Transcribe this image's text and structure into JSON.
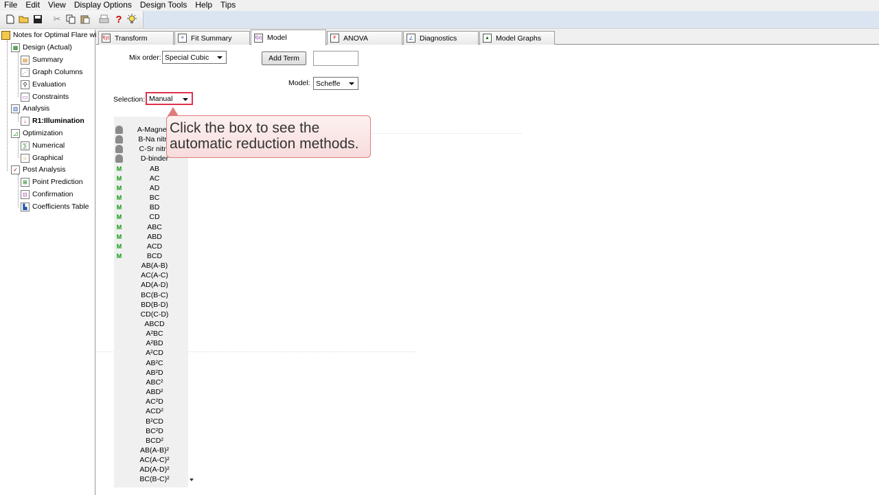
{
  "menubar": {
    "items": [
      "File",
      "Edit",
      "View",
      "Display Options",
      "Design Tools",
      "Help",
      "Tips"
    ]
  },
  "toolbar": {
    "icons": [
      "new-file-icon",
      "open-folder-icon",
      "save-icon",
      "cut-icon",
      "copy-icon",
      "paste-icon",
      "print-icon",
      "help-icon",
      "tip-bulb-icon"
    ],
    "help_glyph": "?"
  },
  "tree": {
    "root": "Notes for Optimal Flare wit",
    "design": "Design (Actual)",
    "summary": "Summary",
    "graph_columns": "Graph Columns",
    "evaluation": "Evaluation",
    "constraints": "Constraints",
    "analysis": "Analysis",
    "r1": "R1:Illumination",
    "optimization": "Optimization",
    "numerical": "Numerical",
    "graphical": "Graphical",
    "post_analysis": "Post Analysis",
    "point_prediction": "Point Prediction",
    "confirmation": "Confirmation",
    "coefficients_table": "Coefficients Table"
  },
  "tabs": [
    {
      "label": "Transform",
      "icon": "f(y)"
    },
    {
      "label": "Fit Summary",
      "icon": "≡"
    },
    {
      "label": "Model",
      "icon": "f(x)"
    },
    {
      "label": "ANOVA",
      "icon": "F"
    },
    {
      "label": "Diagnostics",
      "icon": "∠"
    },
    {
      "label": "Model Graphs",
      "icon": "▲"
    }
  ],
  "model": {
    "mix_order_label": "Mix order:",
    "mix_order_value": "Special Cubic",
    "add_term_label": "Add Term",
    "add_term_value": "",
    "model_label": "Model:",
    "model_value": "Scheffe",
    "selection_label": "Selection:",
    "selection_value": "Manual"
  },
  "terms": [
    {
      "name": "A-Magnesi",
      "mark": "lock"
    },
    {
      "name": "B-Na nitra",
      "mark": "lock"
    },
    {
      "name": "C-Sr nitra",
      "mark": "lock"
    },
    {
      "name": "D-binder",
      "mark": "lock"
    },
    {
      "name": "AB",
      "mark": "M"
    },
    {
      "name": "AC",
      "mark": "M"
    },
    {
      "name": "AD",
      "mark": "M"
    },
    {
      "name": "BC",
      "mark": "M"
    },
    {
      "name": "BD",
      "mark": "M"
    },
    {
      "name": "CD",
      "mark": "M"
    },
    {
      "name": "ABC",
      "mark": "M"
    },
    {
      "name": "ABD",
      "mark": "M"
    },
    {
      "name": "ACD",
      "mark": "M"
    },
    {
      "name": "BCD",
      "mark": "M"
    },
    {
      "name": "AB(A-B)",
      "mark": ""
    },
    {
      "name": "AC(A-C)",
      "mark": ""
    },
    {
      "name": "AD(A-D)",
      "mark": ""
    },
    {
      "name": "BC(B-C)",
      "mark": ""
    },
    {
      "name": "BD(B-D)",
      "mark": ""
    },
    {
      "name": "CD(C-D)",
      "mark": ""
    },
    {
      "name": "ABCD",
      "mark": ""
    },
    {
      "name": "A²BC",
      "mark": ""
    },
    {
      "name": "A²BD",
      "mark": ""
    },
    {
      "name": "A²CD",
      "mark": ""
    },
    {
      "name": "AB²C",
      "mark": ""
    },
    {
      "name": "AB²D",
      "mark": ""
    },
    {
      "name": "ABC²",
      "mark": ""
    },
    {
      "name": "ABD²",
      "mark": ""
    },
    {
      "name": "AC²D",
      "mark": ""
    },
    {
      "name": "ACD²",
      "mark": ""
    },
    {
      "name": "B²CD",
      "mark": ""
    },
    {
      "name": "BC²D",
      "mark": ""
    },
    {
      "name": "BCD²",
      "mark": ""
    },
    {
      "name": "AB(A-B)²",
      "mark": ""
    },
    {
      "name": "AC(A-C)²",
      "mark": ""
    },
    {
      "name": "AD(A-D)²",
      "mark": ""
    },
    {
      "name": "BC(B-C)²",
      "mark": ""
    }
  ],
  "callout": {
    "line1": "Click the box to see the",
    "line2": "automatic reduction methods."
  },
  "colors": {
    "highlight_border": "#e0304a",
    "callout_border": "#e07b7b",
    "m_mark": "#0a9a0a"
  }
}
